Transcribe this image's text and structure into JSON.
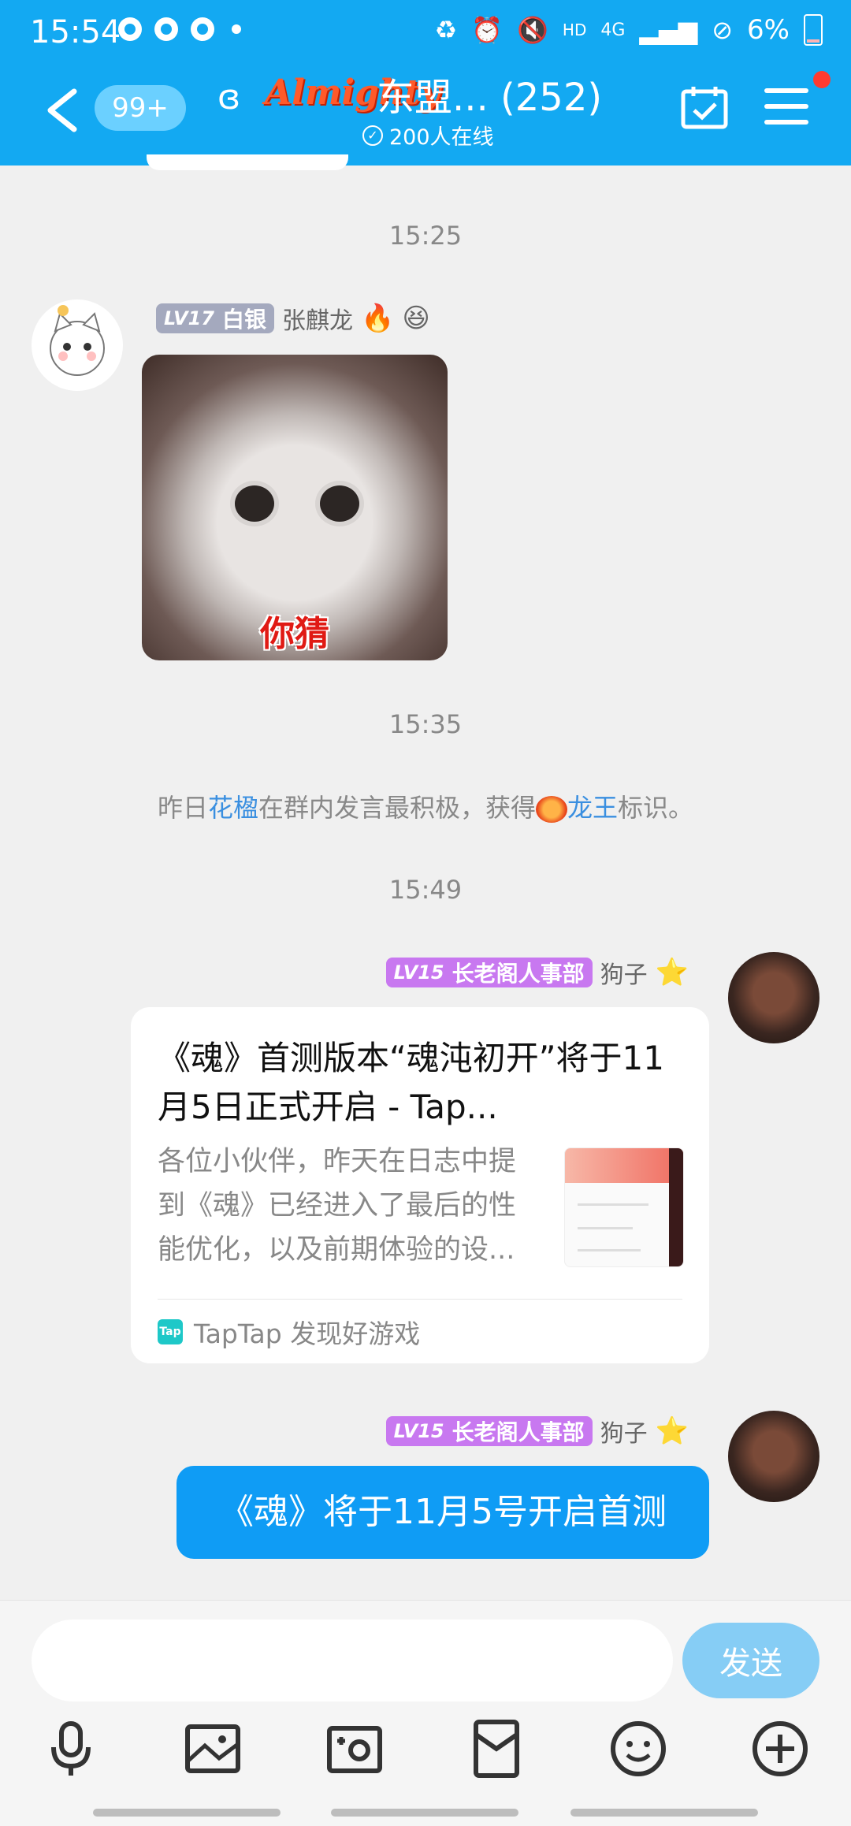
{
  "status": {
    "time": "15:54",
    "right": {
      "hd": "HD",
      "net": "4G",
      "battery": "6%"
    }
  },
  "header": {
    "unread_badge": "99+",
    "brand_logo_text": "Almighty",
    "title": "东盟... (252)",
    "online": "200人在线"
  },
  "messages": {
    "time1": "15:25",
    "msg1": {
      "level": "LV17",
      "title": "白银",
      "name": "张麒龙",
      "sticker_text": "你猜"
    },
    "time2": "15:35",
    "notice": {
      "pre": "昨日",
      "user": "花楹",
      "mid": "在群内发言最积极，获得",
      "badge": "龙王",
      "post": "标识。"
    },
    "time3": "15:49",
    "msg2": {
      "level": "LV15",
      "title": "长老阁人事部",
      "name": "狗子",
      "card_title": "《魂》首测版本“魂沌初开”将于11月5日正式开启 - Tap...",
      "card_desc": "各位小伙伴，昨天在日志中提到《魂》已经进入了最后的性能优化，以及前期体验的设...",
      "card_source_icon": "Tap",
      "card_source": "TapTap 发现好游戏"
    },
    "msg3": {
      "level": "LV15",
      "title": "长老阁人事部",
      "name": "狗子",
      "text": "《魂》将于11月5号开启首测"
    }
  },
  "input": {
    "value": "",
    "placeholder": "",
    "send_label": "发送"
  },
  "toolbar": {
    "icons": [
      "microphone-icon",
      "image-icon",
      "camera-icon",
      "red-packet-icon",
      "emoji-icon",
      "plus-icon"
    ]
  },
  "colors": {
    "header_bg": "#13a9f2",
    "bubble_blue": "#0f9cf5",
    "send_btn": "#86cdf5",
    "link": "#3a8fe0",
    "badge_silver": "#a4a9be",
    "badge_purple": "#c878f0"
  }
}
